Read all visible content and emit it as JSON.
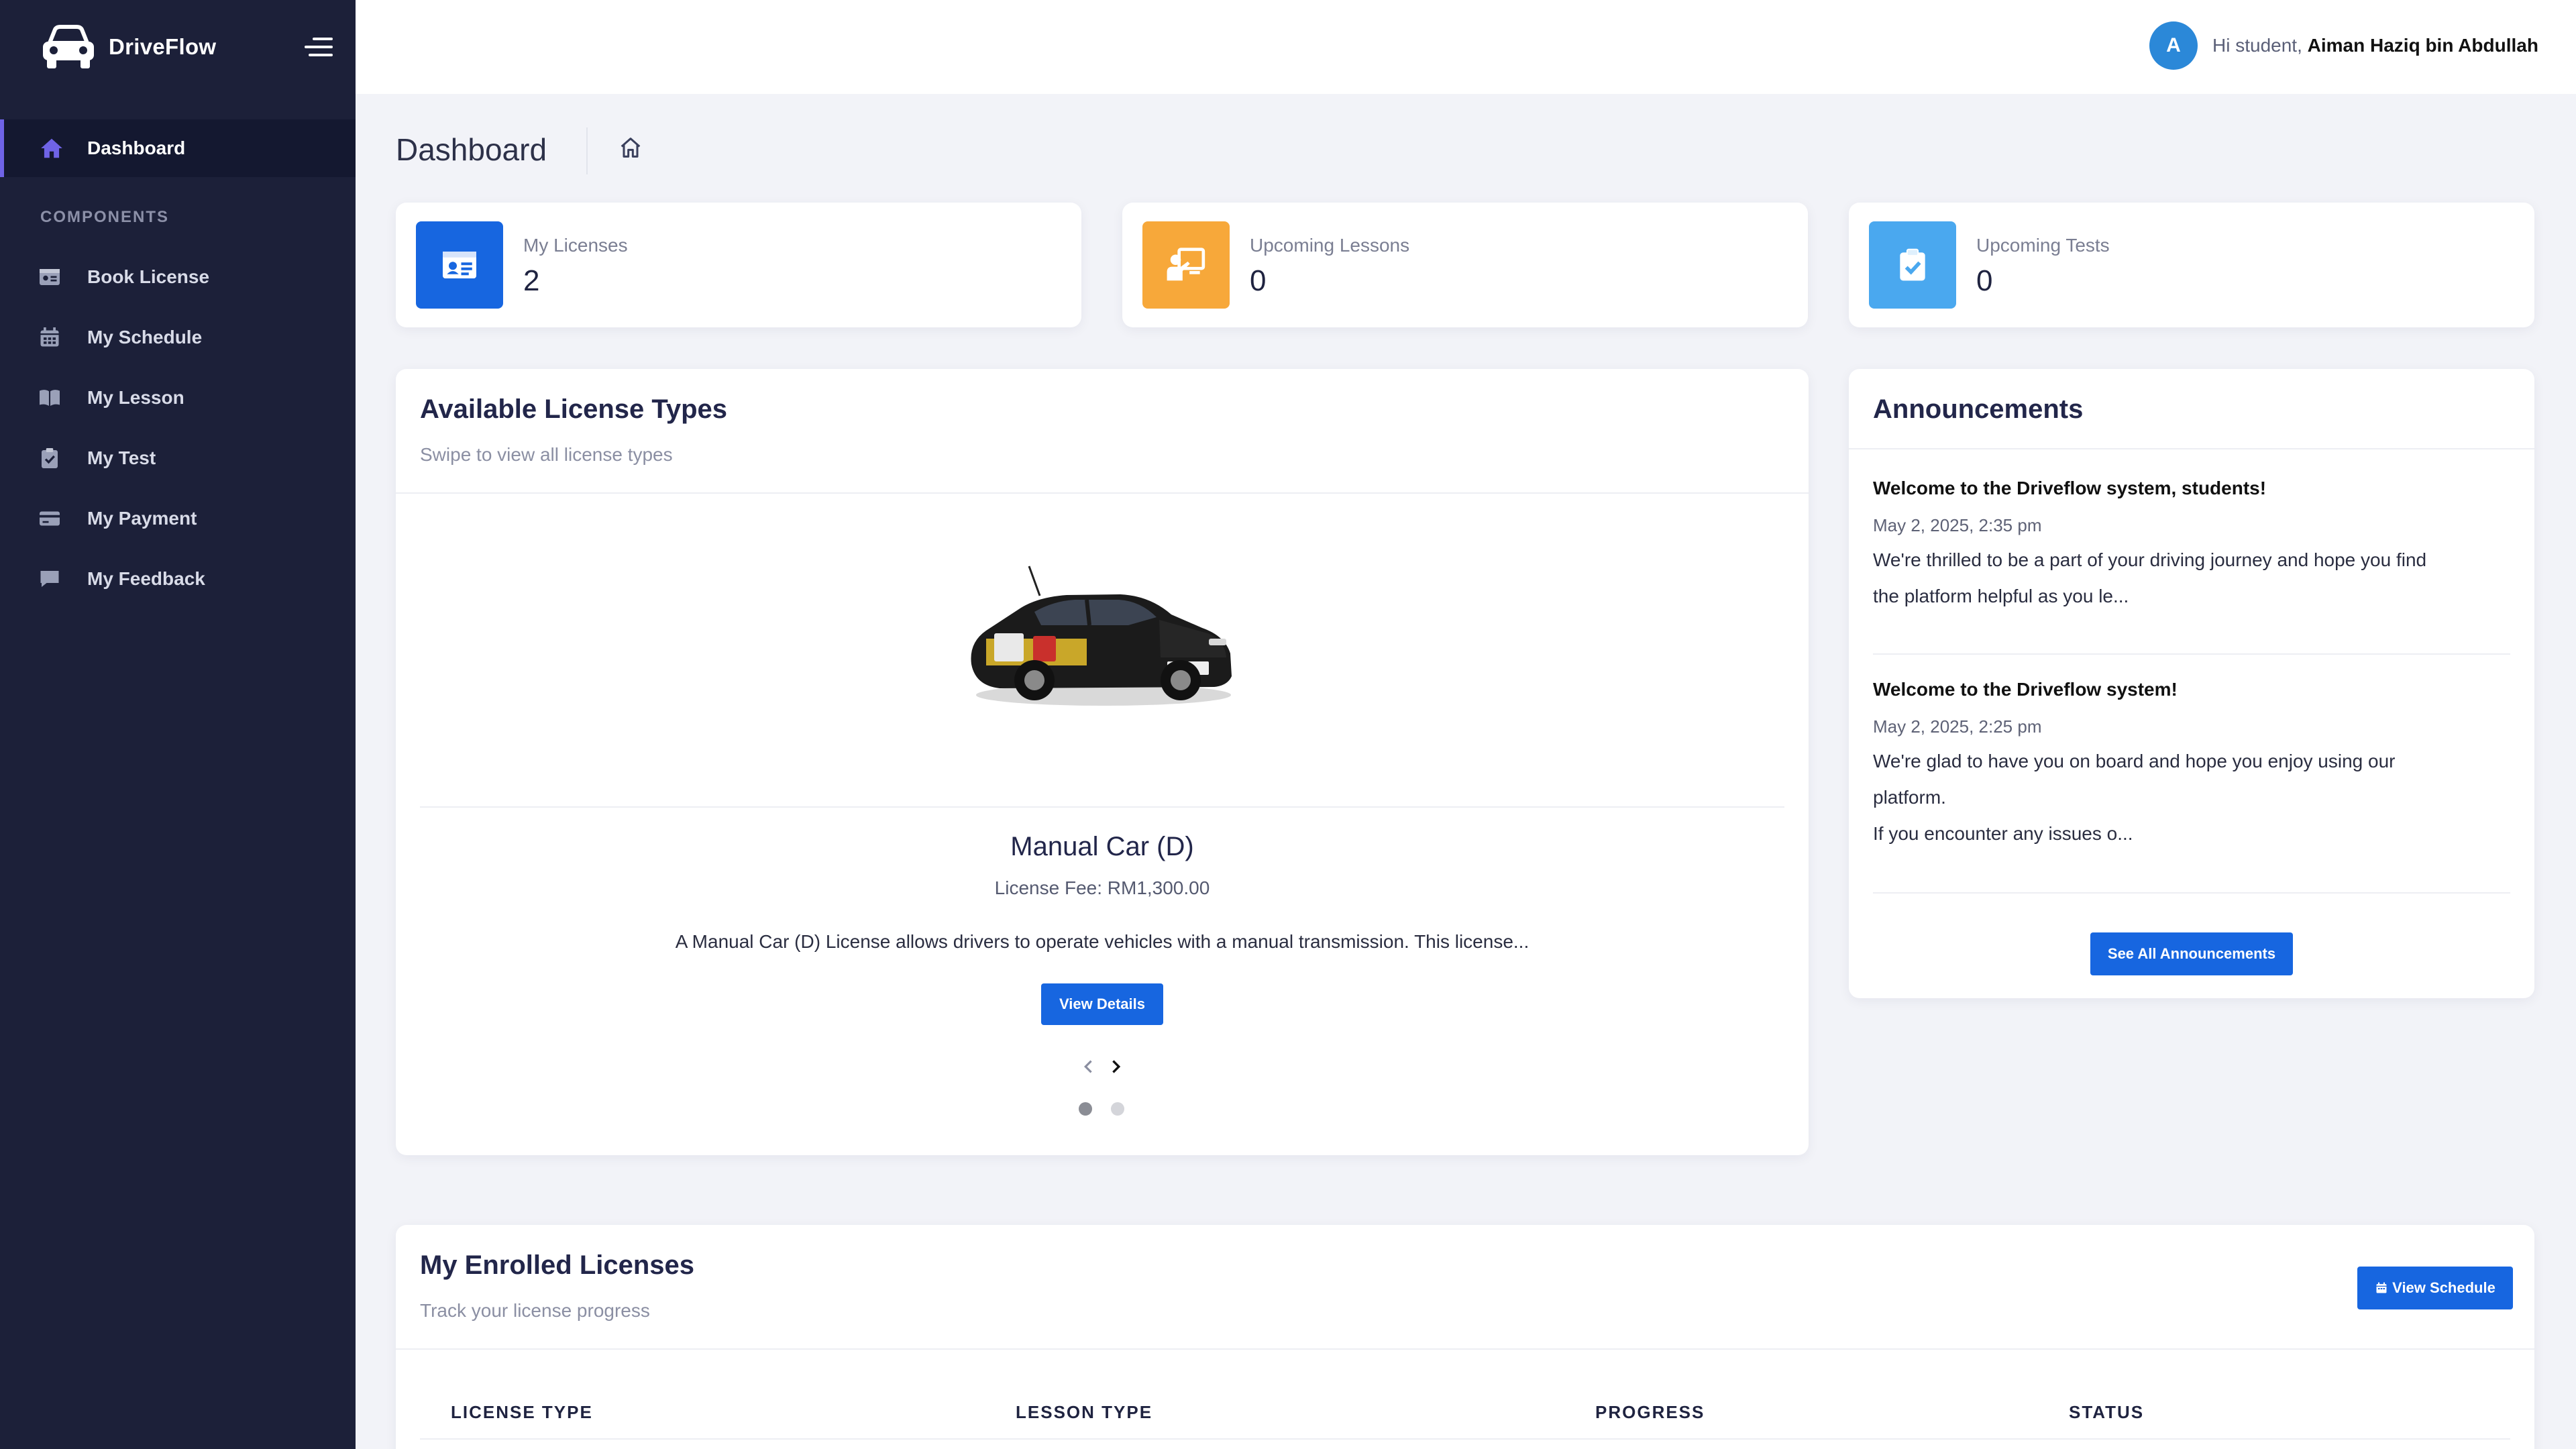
{
  "brand": {
    "name": "DriveFlow"
  },
  "sidebar": {
    "active_item": "Dashboard",
    "section_heading": "COMPONENTS",
    "items": [
      {
        "label": "Book License",
        "icon": "id-card-icon"
      },
      {
        "label": "My Schedule",
        "icon": "calendar-icon"
      },
      {
        "label": "My Lesson",
        "icon": "book-icon"
      },
      {
        "label": "My Test",
        "icon": "clipboard-check-icon"
      },
      {
        "label": "My Payment",
        "icon": "credit-card-icon"
      },
      {
        "label": "My Feedback",
        "icon": "comment-icon"
      }
    ]
  },
  "header": {
    "avatar_initial": "A",
    "greeting_prefix": "Hi student, ",
    "user_name": "Aiman Haziq bin Abdullah"
  },
  "page": {
    "title": "Dashboard"
  },
  "stats": [
    {
      "label": "My Licenses",
      "value": "2",
      "color": "#1766e0",
      "icon": "id-card-icon"
    },
    {
      "label": "Upcoming Lessons",
      "value": "0",
      "color": "#f7a83a",
      "icon": "chalkboard-teacher-icon"
    },
    {
      "label": "Upcoming Tests",
      "value": "0",
      "color": "#4aa8ef",
      "icon": "clipboard-check-icon"
    }
  ],
  "license_types": {
    "title": "Available License Types",
    "subtitle": "Swipe to view all license types",
    "current": {
      "name": "Manual Car (D)",
      "fee": "License Fee: RM1,300.00",
      "description": "A Manual Car (D) License allows drivers to operate vehicles with a manual transmission. This license...",
      "button": "View Details"
    },
    "slide_count": 2,
    "active_slide": 1
  },
  "announcements": {
    "title": "Announcements",
    "items": [
      {
        "title": "Welcome to the Driveflow system, students!",
        "date": "May 2, 2025, 2:35 pm",
        "body_line1": "We're thrilled to be a part of your driving journey and hope you find",
        "body_line2": "the platform helpful as you le..."
      },
      {
        "title": "Welcome to the Driveflow system!",
        "date": "May 2, 2025, 2:25 pm",
        "body_line1": "We're glad to have you on board and hope you enjoy using our",
        "body_line2": "platform.",
        "body_line3": "If you encounter any issues o..."
      }
    ],
    "button": "See All Announcements"
  },
  "enrolled": {
    "title": "My Enrolled Licenses",
    "subtitle": "Track your license progress",
    "button": "View Schedule",
    "columns": [
      "LICENSE TYPE",
      "LESSON TYPE",
      "PROGRESS",
      "STATUS"
    ]
  },
  "colors": {
    "sidebar_bg": "#1c2039",
    "accent": "#6f63e6",
    "primary": "#1766e0"
  }
}
